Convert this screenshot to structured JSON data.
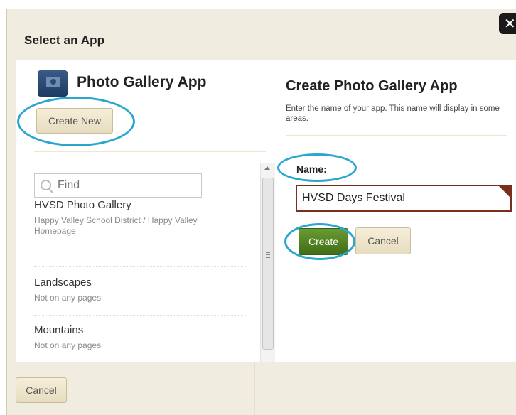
{
  "dialog": {
    "title": "Select an App",
    "close_label": "✕",
    "footer_cancel_label": "Cancel"
  },
  "left": {
    "app_name": "Photo Gallery App",
    "create_new_label": "Create New",
    "search": {
      "placeholder": "Find"
    },
    "items": [
      {
        "title": "HVSD Photo Gallery",
        "subtitle": "Happy Valley School District / Happy Valley Homepage"
      },
      {
        "title": "Landscapes",
        "subtitle": "Not on any pages"
      },
      {
        "title": "Mountains",
        "subtitle": "Not on any pages"
      }
    ]
  },
  "right": {
    "title": "Create Photo Gallery App",
    "description": "Enter the name of your app. This name will display in some areas.",
    "name_label": "Name:",
    "name_value": "HVSD Days Festival",
    "create_label": "Create",
    "cancel_label": "Cancel"
  },
  "colors": {
    "dialog_bg": "#f0ece0",
    "highlight_oval": "#2aa6cf",
    "create_green": "#4f7f1f",
    "input_border": "#7a2e1c"
  },
  "icons": {
    "app": "camera-icon",
    "search": "search-icon",
    "close": "close-icon"
  }
}
